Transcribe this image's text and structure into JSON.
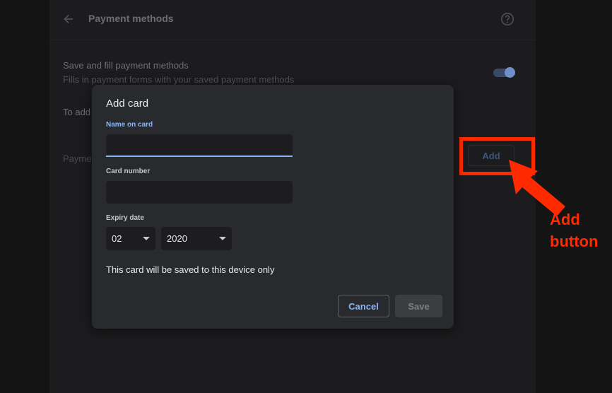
{
  "page": {
    "title": "Payment methods",
    "setting_title": "Save and fill payment methods",
    "setting_desc": "Fills in payment forms with your saved payment methods",
    "to_add_text": "To add",
    "payment_label": "Payme",
    "add_button": "Add",
    "toggle_on": true
  },
  "dialog": {
    "title": "Add card",
    "name_label": "Name on card",
    "name_value": "",
    "card_label": "Card number",
    "card_value": "",
    "expiry_label": "Expiry date",
    "expiry_month": "02",
    "expiry_year": "2020",
    "note": "This card will be saved to this device only",
    "cancel_label": "Cancel",
    "save_label": "Save"
  },
  "annotation": {
    "text": "Add\nbutton",
    "color": "#ff2a00"
  },
  "icons": {
    "back": "back-arrow-icon",
    "help": "help-circle-icon",
    "dropdown": "caret-down-icon"
  }
}
